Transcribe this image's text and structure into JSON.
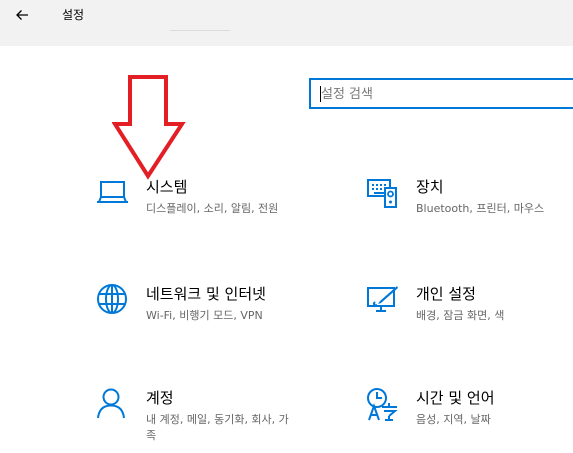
{
  "window": {
    "title": "설정"
  },
  "search": {
    "placeholder": "설정 검색"
  },
  "tiles": [
    {
      "name": "시스템",
      "desc": "디스플레이, 소리, 알림, 전원",
      "icon": "laptop-icon"
    },
    {
      "name": "장치",
      "desc": "Bluetooth, 프린터, 마우스",
      "icon": "devices-icon"
    },
    {
      "name": "네트워크 및 인터넷",
      "desc": "Wi-Fi, 비행기 모드, VPN",
      "icon": "globe-icon"
    },
    {
      "name": "개인 설정",
      "desc": "배경, 잠금 화면, 색",
      "icon": "personalization-icon"
    },
    {
      "name": "계정",
      "desc": "내 계정, 메일, 동기화, 회사, 가족",
      "icon": "person-icon"
    },
    {
      "name": "시간 및 언어",
      "desc": "음성, 지역, 날짜",
      "icon": "time-language-icon"
    }
  ],
  "colors": {
    "accent": "#0078d7",
    "annotation_arrow": "#e31e24",
    "titlebar_bg": "#f2f2f2"
  }
}
